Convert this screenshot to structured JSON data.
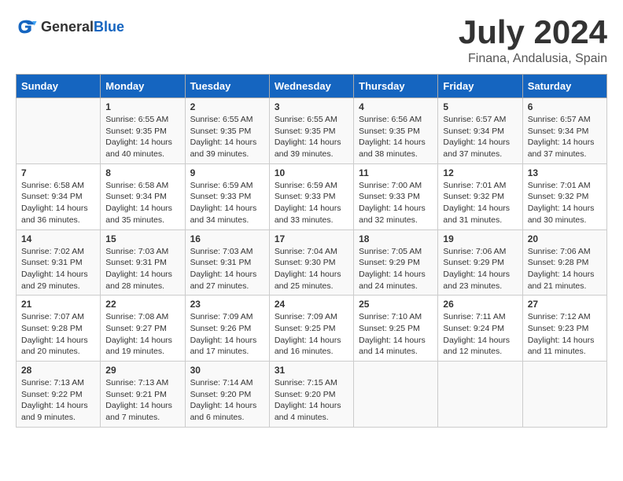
{
  "header": {
    "logo_general": "General",
    "logo_blue": "Blue",
    "month_year": "July 2024",
    "location": "Finana, Andalusia, Spain"
  },
  "days_of_week": [
    "Sunday",
    "Monday",
    "Tuesday",
    "Wednesday",
    "Thursday",
    "Friday",
    "Saturday"
  ],
  "weeks": [
    [
      {
        "day": "",
        "sunrise": "",
        "sunset": "",
        "daylight": ""
      },
      {
        "day": "1",
        "sunrise": "Sunrise: 6:55 AM",
        "sunset": "Sunset: 9:35 PM",
        "daylight": "Daylight: 14 hours and 40 minutes."
      },
      {
        "day": "2",
        "sunrise": "Sunrise: 6:55 AM",
        "sunset": "Sunset: 9:35 PM",
        "daylight": "Daylight: 14 hours and 39 minutes."
      },
      {
        "day": "3",
        "sunrise": "Sunrise: 6:55 AM",
        "sunset": "Sunset: 9:35 PM",
        "daylight": "Daylight: 14 hours and 39 minutes."
      },
      {
        "day": "4",
        "sunrise": "Sunrise: 6:56 AM",
        "sunset": "Sunset: 9:35 PM",
        "daylight": "Daylight: 14 hours and 38 minutes."
      },
      {
        "day": "5",
        "sunrise": "Sunrise: 6:57 AM",
        "sunset": "Sunset: 9:34 PM",
        "daylight": "Daylight: 14 hours and 37 minutes."
      },
      {
        "day": "6",
        "sunrise": "Sunrise: 6:57 AM",
        "sunset": "Sunset: 9:34 PM",
        "daylight": "Daylight: 14 hours and 37 minutes."
      }
    ],
    [
      {
        "day": "7",
        "sunrise": "Sunrise: 6:58 AM",
        "sunset": "Sunset: 9:34 PM",
        "daylight": "Daylight: 14 hours and 36 minutes."
      },
      {
        "day": "8",
        "sunrise": "Sunrise: 6:58 AM",
        "sunset": "Sunset: 9:34 PM",
        "daylight": "Daylight: 14 hours and 35 minutes."
      },
      {
        "day": "9",
        "sunrise": "Sunrise: 6:59 AM",
        "sunset": "Sunset: 9:33 PM",
        "daylight": "Daylight: 14 hours and 34 minutes."
      },
      {
        "day": "10",
        "sunrise": "Sunrise: 6:59 AM",
        "sunset": "Sunset: 9:33 PM",
        "daylight": "Daylight: 14 hours and 33 minutes."
      },
      {
        "day": "11",
        "sunrise": "Sunrise: 7:00 AM",
        "sunset": "Sunset: 9:33 PM",
        "daylight": "Daylight: 14 hours and 32 minutes."
      },
      {
        "day": "12",
        "sunrise": "Sunrise: 7:01 AM",
        "sunset": "Sunset: 9:32 PM",
        "daylight": "Daylight: 14 hours and 31 minutes."
      },
      {
        "day": "13",
        "sunrise": "Sunrise: 7:01 AM",
        "sunset": "Sunset: 9:32 PM",
        "daylight": "Daylight: 14 hours and 30 minutes."
      }
    ],
    [
      {
        "day": "14",
        "sunrise": "Sunrise: 7:02 AM",
        "sunset": "Sunset: 9:31 PM",
        "daylight": "Daylight: 14 hours and 29 minutes."
      },
      {
        "day": "15",
        "sunrise": "Sunrise: 7:03 AM",
        "sunset": "Sunset: 9:31 PM",
        "daylight": "Daylight: 14 hours and 28 minutes."
      },
      {
        "day": "16",
        "sunrise": "Sunrise: 7:03 AM",
        "sunset": "Sunset: 9:31 PM",
        "daylight": "Daylight: 14 hours and 27 minutes."
      },
      {
        "day": "17",
        "sunrise": "Sunrise: 7:04 AM",
        "sunset": "Sunset: 9:30 PM",
        "daylight": "Daylight: 14 hours and 25 minutes."
      },
      {
        "day": "18",
        "sunrise": "Sunrise: 7:05 AM",
        "sunset": "Sunset: 9:29 PM",
        "daylight": "Daylight: 14 hours and 24 minutes."
      },
      {
        "day": "19",
        "sunrise": "Sunrise: 7:06 AM",
        "sunset": "Sunset: 9:29 PM",
        "daylight": "Daylight: 14 hours and 23 minutes."
      },
      {
        "day": "20",
        "sunrise": "Sunrise: 7:06 AM",
        "sunset": "Sunset: 9:28 PM",
        "daylight": "Daylight: 14 hours and 21 minutes."
      }
    ],
    [
      {
        "day": "21",
        "sunrise": "Sunrise: 7:07 AM",
        "sunset": "Sunset: 9:28 PM",
        "daylight": "Daylight: 14 hours and 20 minutes."
      },
      {
        "day": "22",
        "sunrise": "Sunrise: 7:08 AM",
        "sunset": "Sunset: 9:27 PM",
        "daylight": "Daylight: 14 hours and 19 minutes."
      },
      {
        "day": "23",
        "sunrise": "Sunrise: 7:09 AM",
        "sunset": "Sunset: 9:26 PM",
        "daylight": "Daylight: 14 hours and 17 minutes."
      },
      {
        "day": "24",
        "sunrise": "Sunrise: 7:09 AM",
        "sunset": "Sunset: 9:25 PM",
        "daylight": "Daylight: 14 hours and 16 minutes."
      },
      {
        "day": "25",
        "sunrise": "Sunrise: 7:10 AM",
        "sunset": "Sunset: 9:25 PM",
        "daylight": "Daylight: 14 hours and 14 minutes."
      },
      {
        "day": "26",
        "sunrise": "Sunrise: 7:11 AM",
        "sunset": "Sunset: 9:24 PM",
        "daylight": "Daylight: 14 hours and 12 minutes."
      },
      {
        "day": "27",
        "sunrise": "Sunrise: 7:12 AM",
        "sunset": "Sunset: 9:23 PM",
        "daylight": "Daylight: 14 hours and 11 minutes."
      }
    ],
    [
      {
        "day": "28",
        "sunrise": "Sunrise: 7:13 AM",
        "sunset": "Sunset: 9:22 PM",
        "daylight": "Daylight: 14 hours and 9 minutes."
      },
      {
        "day": "29",
        "sunrise": "Sunrise: 7:13 AM",
        "sunset": "Sunset: 9:21 PM",
        "daylight": "Daylight: 14 hours and 7 minutes."
      },
      {
        "day": "30",
        "sunrise": "Sunrise: 7:14 AM",
        "sunset": "Sunset: 9:20 PM",
        "daylight": "Daylight: 14 hours and 6 minutes."
      },
      {
        "day": "31",
        "sunrise": "Sunrise: 7:15 AM",
        "sunset": "Sunset: 9:20 PM",
        "daylight": "Daylight: 14 hours and 4 minutes."
      },
      {
        "day": "",
        "sunrise": "",
        "sunset": "",
        "daylight": ""
      },
      {
        "day": "",
        "sunrise": "",
        "sunset": "",
        "daylight": ""
      },
      {
        "day": "",
        "sunrise": "",
        "sunset": "",
        "daylight": ""
      }
    ]
  ]
}
